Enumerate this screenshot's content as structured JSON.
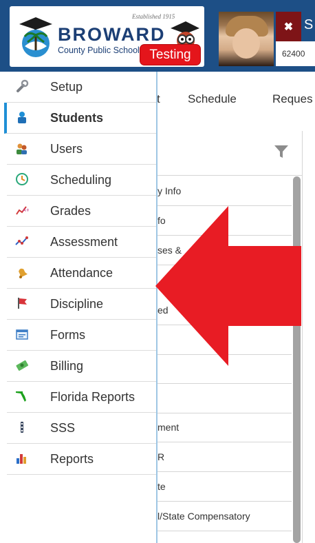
{
  "header": {
    "logo_established": "Established 1915",
    "logo_name": "BROWARD",
    "logo_subtitle": "County Public Schools",
    "testing_badge": "Testing",
    "student_initial": "S",
    "student_id": "62400"
  },
  "tabs": [
    {
      "label": "t"
    },
    {
      "label": "Schedule"
    },
    {
      "label": "Reques"
    }
  ],
  "panel_rows": [
    {
      "label": "y Info"
    },
    {
      "label": "fo"
    },
    {
      "label": "ses &"
    },
    {
      "label": "ed"
    },
    {
      "label": ""
    },
    {
      "label": ""
    },
    {
      "label": ""
    },
    {
      "label": "ment"
    },
    {
      "label": "R"
    },
    {
      "label": "te"
    },
    {
      "label": "l/State Compensatory"
    }
  ],
  "menu": {
    "items": [
      {
        "label": "Setup",
        "icon": "wrench-icon"
      },
      {
        "label": "Students",
        "icon": "student-icon",
        "active": true
      },
      {
        "label": "Users",
        "icon": "users-icon"
      },
      {
        "label": "Scheduling",
        "icon": "clock-icon"
      },
      {
        "label": "Grades",
        "icon": "grades-chart-icon"
      },
      {
        "label": "Assessment",
        "icon": "assessment-chart-icon"
      },
      {
        "label": "Attendance",
        "icon": "bell-icon"
      },
      {
        "label": "Discipline",
        "icon": "flag-icon"
      },
      {
        "label": "Forms",
        "icon": "form-icon"
      },
      {
        "label": "Billing",
        "icon": "money-icon"
      },
      {
        "label": "Florida Reports",
        "icon": "florida-icon"
      },
      {
        "label": "SSS",
        "icon": "sss-icon"
      },
      {
        "label": "Reports",
        "icon": "bar-chart-icon"
      }
    ]
  },
  "colors": {
    "header_bg": "#1d4f86",
    "testing_red": "#e4151b",
    "arrow_red": "#e81c24",
    "active_accent": "#1f8fd6"
  }
}
